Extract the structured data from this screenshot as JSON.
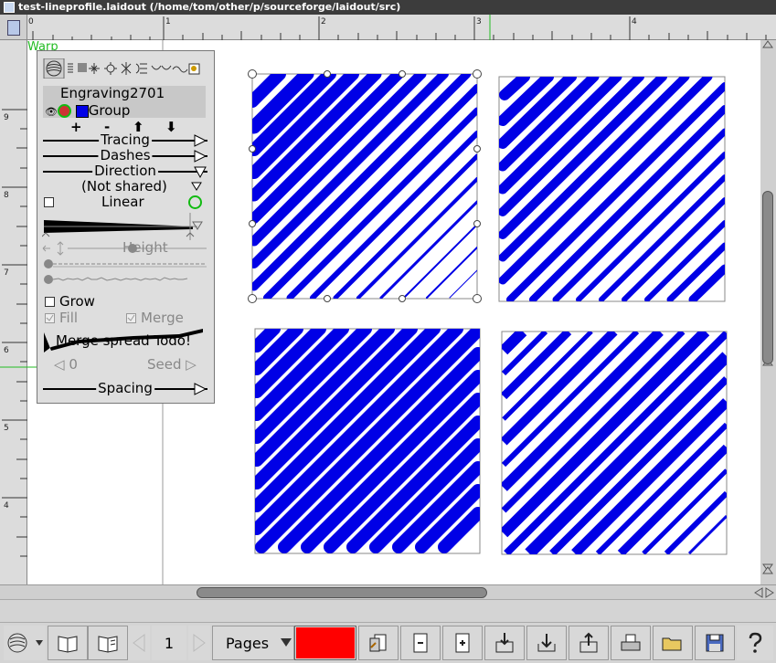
{
  "window": {
    "title": "test-lineprofile.laidout (/home/tom/other/p/sourceforge/laidout/src)"
  },
  "hruler": {
    "labels": [
      "0",
      "1",
      "2",
      "3",
      "4",
      "5"
    ]
  },
  "vruler": {
    "labels": [
      "9",
      "8",
      "7",
      "6",
      "5",
      "4"
    ]
  },
  "canvas": {
    "mode_label": "Warp",
    "fill_color": "#0000e6"
  },
  "panel": {
    "object_name": "Engraving2701",
    "group_label": "Group",
    "layer_buttons": [
      "+",
      "-",
      "⬆",
      "⬇"
    ],
    "tracing_label": "Tracing",
    "dashes_label": "Dashes",
    "direction_label": "Direction",
    "not_shared_label": "(Not shared)",
    "linear_label": "Linear",
    "height_label": "Height",
    "grow_label": "Grow",
    "fill_label": "Fill",
    "merge_label": "Merge",
    "merge_spread_label": "Merge spread Todo!",
    "seed_value": "0",
    "seed_label": "Seed",
    "spacing_label": "Spacing"
  },
  "toolbar": {
    "page_number": "1",
    "pages_label": "Pages",
    "color_swatch": "#ff0000"
  }
}
